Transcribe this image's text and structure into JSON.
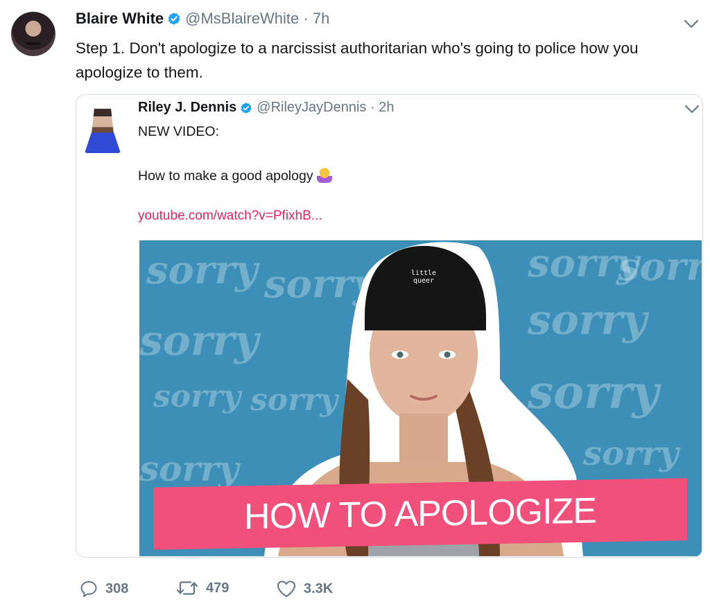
{
  "tweet": {
    "author_name": "Blaire White",
    "handle_time": "@MsBlaireWhite · 7h",
    "text": "Step 1. Don't apologize to a narcissist authoritarian who's going to police how you apologize to them."
  },
  "quoted": {
    "author_name": "Riley J. Dennis",
    "handle_time": "@RileyJayDennis · 2h",
    "text": "NEW VIDEO:\n\nHow to make a good apology",
    "emoji": "woman-tipping-hand",
    "link": "youtube.com/watch?v=PfixhB...",
    "thumbnail": {
      "banner_text": "HOW TO APOLOGIZE",
      "beanie_text": "little queer",
      "background_word": "sorry"
    }
  },
  "actions": {
    "replies": "308",
    "retweets": "479",
    "likes": "3.3K"
  },
  "icons": {
    "verified": "verified-badge-icon",
    "caret": "chevron-down-icon",
    "reply": "reply-icon",
    "retweet": "retweet-icon",
    "like": "heart-icon"
  },
  "colors": {
    "verified_blue": "#1da1f2",
    "link_pink": "#e0245e",
    "muted": "#657786",
    "banner_pink": "#f0507a",
    "thumb_blue": "#3d8fb8"
  }
}
